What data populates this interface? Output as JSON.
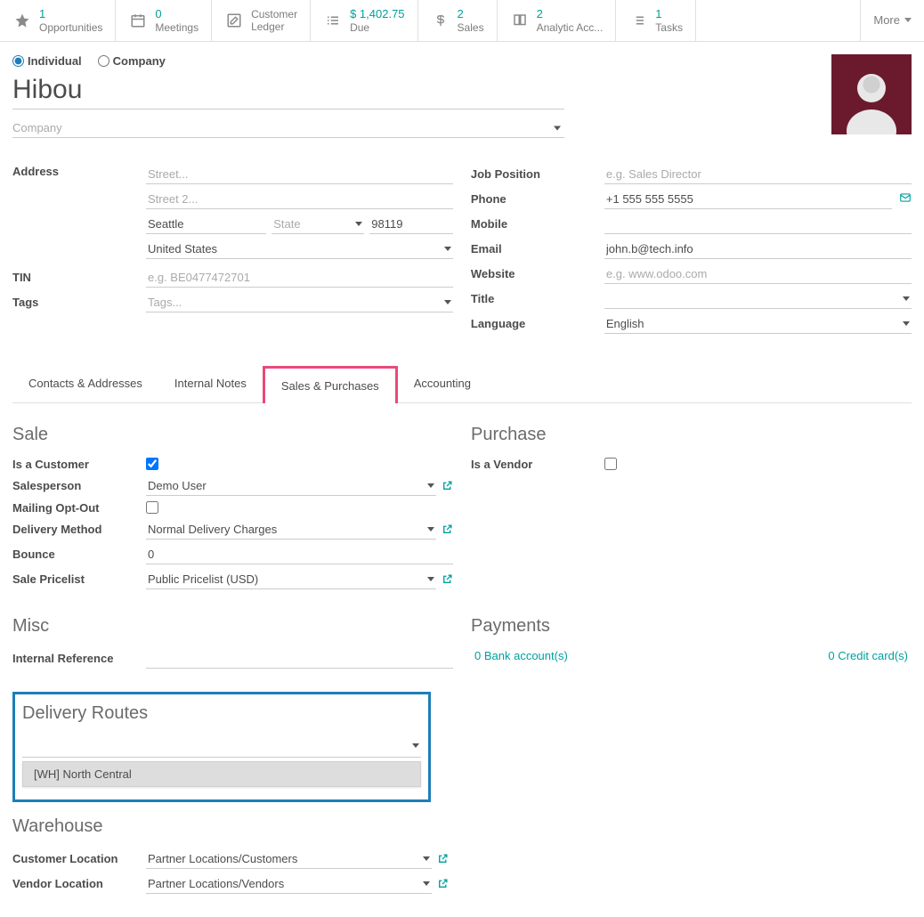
{
  "stats": {
    "opportunities": {
      "value": "1",
      "label": "Opportunities"
    },
    "meetings": {
      "value": "0",
      "label": "Meetings"
    },
    "ledger": {
      "label": "Customer",
      "label2": "Ledger"
    },
    "due": {
      "value": "$ 1,402.75",
      "label": "Due"
    },
    "sales": {
      "value": "2",
      "label": "Sales"
    },
    "analytic": {
      "value": "2",
      "label": "Analytic Acc..."
    },
    "tasks": {
      "value": "1",
      "label": "Tasks"
    },
    "more": "More"
  },
  "type": {
    "individual": "Individual",
    "company": "Company"
  },
  "name": "Hibou",
  "company_placeholder": "Company",
  "address": {
    "label": "Address",
    "street_ph": "Street...",
    "street2_ph": "Street 2...",
    "city": "Seattle",
    "state_ph": "State",
    "zip": "98119",
    "country": "United States"
  },
  "tin": {
    "label": "TIN",
    "placeholder": "e.g. BE0477472701"
  },
  "tags": {
    "label": "Tags",
    "placeholder": "Tags..."
  },
  "rightfields": {
    "job": {
      "label": "Job Position",
      "placeholder": "e.g. Sales Director"
    },
    "phone": {
      "label": "Phone",
      "value": "+1 555 555 5555"
    },
    "mobile": {
      "label": "Mobile"
    },
    "email": {
      "label": "Email",
      "value": "john.b@tech.info"
    },
    "website": {
      "label": "Website",
      "placeholder": "e.g. www.odoo.com"
    },
    "title": {
      "label": "Title"
    },
    "language": {
      "label": "Language",
      "value": "English"
    }
  },
  "tabs": {
    "contacts": "Contacts & Addresses",
    "notes": "Internal Notes",
    "sales": "Sales & Purchases",
    "accounting": "Accounting"
  },
  "sale": {
    "heading": "Sale",
    "is_customer": "Is a Customer",
    "salesperson": {
      "label": "Salesperson",
      "value": "Demo User"
    },
    "mailing": "Mailing Opt-Out",
    "delivery": {
      "label": "Delivery Method",
      "value": "Normal Delivery Charges"
    },
    "bounce": {
      "label": "Bounce",
      "value": "0"
    },
    "pricelist": {
      "label": "Sale Pricelist",
      "value": "Public Pricelist (USD)"
    }
  },
  "purchase": {
    "heading": "Purchase",
    "is_vendor": "Is a Vendor"
  },
  "misc": {
    "heading": "Misc",
    "internal_ref": "Internal Reference"
  },
  "payments": {
    "heading": "Payments",
    "bank": "0 Bank account(s)",
    "credit": "0 Credit card(s)"
  },
  "routes": {
    "heading": "Delivery Routes",
    "option": "[WH] North Central"
  },
  "warehouse": {
    "heading": "Warehouse",
    "customer_loc": {
      "label": "Customer Location",
      "value": "Partner Locations/Customers"
    },
    "vendor_loc": {
      "label": "Vendor Location",
      "value": "Partner Locations/Vendors"
    }
  }
}
